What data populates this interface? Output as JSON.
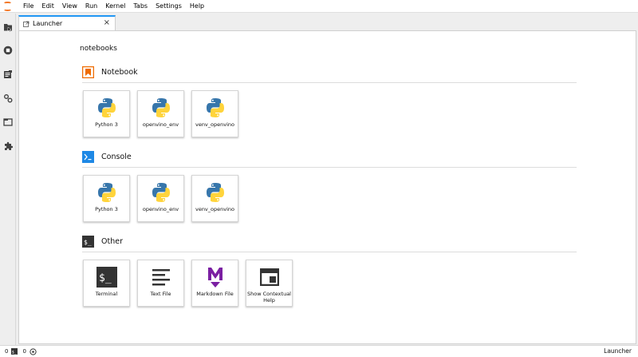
{
  "menubar": {
    "logo": "jupyter-logo",
    "items": [
      "File",
      "Edit",
      "View",
      "Run",
      "Kernel",
      "Tabs",
      "Settings",
      "Help"
    ]
  },
  "sidebar": {
    "icons": [
      "folder-icon",
      "running-icon",
      "commands-icon",
      "property-inspector-icon",
      "tabs-icon",
      "extension-icon"
    ]
  },
  "tabs": [
    {
      "label": "Launcher",
      "icon": "launcher-icon",
      "close": "×"
    }
  ],
  "launcher": {
    "cwd": "notebooks",
    "sections": [
      {
        "title": "Notebook",
        "icon": "notebook-icon",
        "items": [
          {
            "label": "Python 3",
            "icon": "python-icon"
          },
          {
            "label": "openvino_env",
            "icon": "python-icon"
          },
          {
            "label": "venv_openvino",
            "icon": "python-icon"
          }
        ]
      },
      {
        "title": "Console",
        "icon": "console-icon",
        "items": [
          {
            "label": "Python 3",
            "icon": "python-icon"
          },
          {
            "label": "openvino_env",
            "icon": "python-icon"
          },
          {
            "label": "venv_openvino",
            "icon": "python-icon"
          }
        ]
      },
      {
        "title": "Other",
        "icon": "terminal-icon",
        "items": [
          {
            "label": "Terminal",
            "icon": "terminal-icon"
          },
          {
            "label": "Text File",
            "icon": "text-file-icon"
          },
          {
            "label": "Markdown File",
            "icon": "markdown-icon"
          },
          {
            "label": "Show Contextual Help",
            "icon": "contextual-help-icon"
          }
        ]
      }
    ]
  },
  "statusbar": {
    "terminals_count": "0",
    "kernels_count": "0",
    "right_label": "Launcher"
  },
  "colors": {
    "accent": "#2196f3",
    "jupyter_orange": "#f37726",
    "python_blue": "#3776ab",
    "python_yellow": "#ffd43b",
    "markdown_purple": "#7b1fa2",
    "console_blue": "#1e88e5",
    "dark_icon": "#333333"
  }
}
